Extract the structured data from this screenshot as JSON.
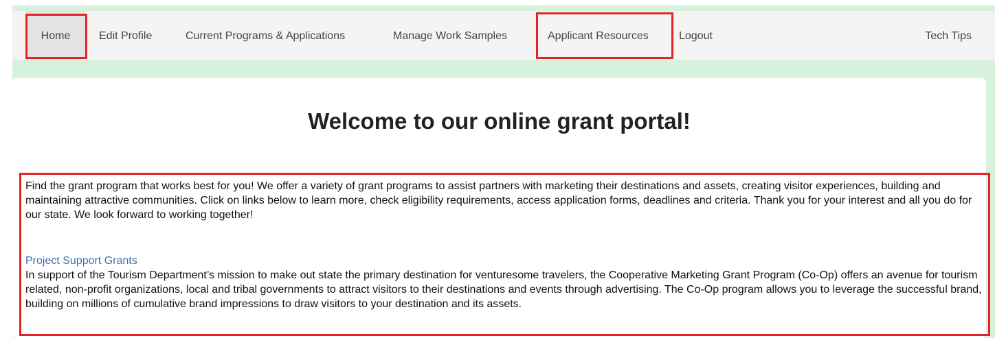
{
  "nav": {
    "items": [
      {
        "label": "Home"
      },
      {
        "label": "Edit Profile"
      },
      {
        "label": "Current Programs & Applications"
      },
      {
        "label": "Manage Work Samples"
      },
      {
        "label": "Applicant Resources"
      },
      {
        "label": "Logout"
      }
    ],
    "tech_tips": "Tech Tips"
  },
  "main": {
    "title": "Welcome to our online grant portal!",
    "intro": "Find the grant program that works best for you! We offer a variety of grant programs to assist partners with marketing their destinations and assets, creating visitor experiences, building and maintaining attractive communities. Click on links below to learn more, check eligibility requirements, access application forms, deadlines and criteria. Thank you for your interest and all you do for our state. We look forward to working together!",
    "sections": [
      {
        "title": "Project Support Grants",
        "description": "In support of the Tourism Department’s mission to make out state the primary destination for venturesome travelers, the Cooperative Marketing Grant Program (Co-Op) offers an avenue for tourism related, non-profit organizations, local and tribal governments to attract visitors to their destinations and events through advertising. The Co-Op program allows you to leverage the successful brand, building on millions of cumulative brand impressions to draw visitors to your destination and its assets."
      }
    ]
  },
  "colors": {
    "page_background": "#d6f2dc",
    "highlight": "#e32424",
    "link": "#3a6fb0"
  }
}
